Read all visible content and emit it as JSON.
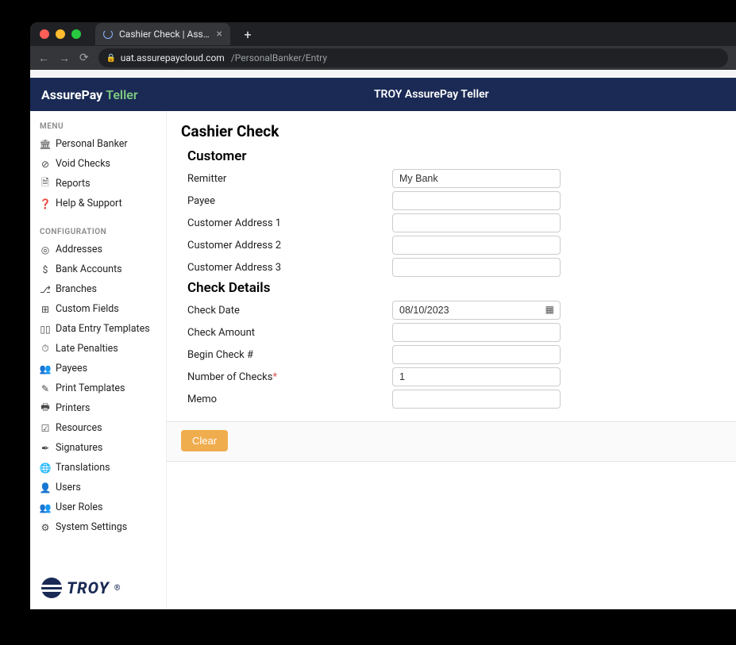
{
  "browser": {
    "tab_title": "Cashier Check | AssurePayClou…",
    "url_host": "uat.assurepaycloud.com",
    "url_path": "/PersonalBanker/Entry"
  },
  "header": {
    "brand_main": "AssurePay",
    "brand_sub": "Teller",
    "title": "TROY AssurePay Teller"
  },
  "sidebar": {
    "menu_label": "MENU",
    "menu_items": [
      {
        "icon": "bank-icon",
        "glyph": "🏛",
        "label": "Personal Banker"
      },
      {
        "icon": "void-icon",
        "glyph": "⊘",
        "label": "Void Checks"
      },
      {
        "icon": "reports-icon",
        "glyph": "🗎",
        "label": "Reports"
      },
      {
        "icon": "help-icon",
        "glyph": "❓",
        "label": "Help & Support"
      }
    ],
    "config_label": "CONFIGURATION",
    "config_items": [
      {
        "icon": "addresses-icon",
        "glyph": "◎",
        "label": "Addresses"
      },
      {
        "icon": "bankaccounts-icon",
        "glyph": "$",
        "label": "Bank Accounts"
      },
      {
        "icon": "branches-icon",
        "glyph": "⎇",
        "label": "Branches"
      },
      {
        "icon": "customfields-icon",
        "glyph": "⊞",
        "label": "Custom Fields"
      },
      {
        "icon": "dataentry-icon",
        "glyph": "▯▯",
        "label": "Data Entry Templates"
      },
      {
        "icon": "latepenalties-icon",
        "glyph": "⏱",
        "label": "Late Penalties"
      },
      {
        "icon": "payees-icon",
        "glyph": "👥",
        "label": "Payees"
      },
      {
        "icon": "printtemplates-icon",
        "glyph": "✎",
        "label": "Print Templates"
      },
      {
        "icon": "printers-icon",
        "glyph": "🖶",
        "label": "Printers"
      },
      {
        "icon": "resources-icon",
        "glyph": "☑",
        "label": "Resources"
      },
      {
        "icon": "signatures-icon",
        "glyph": "✒",
        "label": "Signatures"
      },
      {
        "icon": "translations-icon",
        "glyph": "🌐",
        "label": "Translations"
      },
      {
        "icon": "users-icon",
        "glyph": "👤",
        "label": "Users"
      },
      {
        "icon": "userroles-icon",
        "glyph": "👥",
        "label": "User Roles"
      },
      {
        "icon": "systemsettings-icon",
        "glyph": "⚙",
        "label": "System Settings"
      }
    ],
    "footer_logo": "TROY"
  },
  "page": {
    "title": "Cashier Check",
    "section_customer": "Customer",
    "section_checkdetails": "Check Details",
    "fields": {
      "remitter_label": "Remitter",
      "remitter_value": "My Bank",
      "payee_label": "Payee",
      "payee_value": "",
      "addr1_label": "Customer Address 1",
      "addr1_value": "",
      "addr2_label": "Customer Address 2",
      "addr2_value": "",
      "addr3_label": "Customer Address 3",
      "addr3_value": "",
      "checkdate_label": "Check Date",
      "checkdate_value": "08/10/2023",
      "checkamount_label": "Check Amount",
      "checkamount_value": "",
      "begincheck_label": "Begin Check #",
      "begincheck_value": "",
      "numchecks_label": "Number of Checks",
      "numchecks_value": "1",
      "memo_label": "Memo",
      "memo_value": ""
    },
    "clear_button": "Clear"
  }
}
